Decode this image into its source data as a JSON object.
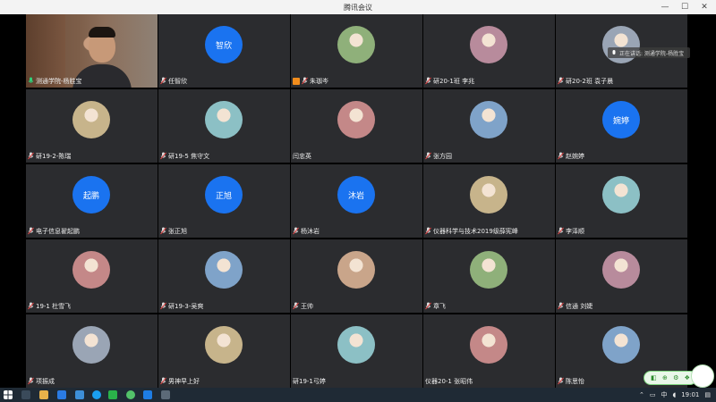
{
  "window": {
    "title": "腾讯会议",
    "minimize": "—",
    "maximize": "☐",
    "close": "✕"
  },
  "speaking": {
    "label": "正在讲话: 测通学院-杨胜宝"
  },
  "participants": [
    {
      "name": "测通学院-杨胜宝",
      "type": "video",
      "mic": "on"
    },
    {
      "name": "任智欣",
      "type": "text",
      "initials": "智欣",
      "mic": "muted"
    },
    {
      "name": "朱珈岑",
      "type": "image",
      "mic": "muted",
      "badge": true
    },
    {
      "name": "研20-1班 李兆",
      "type": "image",
      "mic": "muted"
    },
    {
      "name": "研20-2班 袁子晨",
      "type": "image",
      "mic": "muted"
    },
    {
      "name": "研19-2-陈瑞",
      "type": "image",
      "mic": "muted"
    },
    {
      "name": "研19-5 焦守文",
      "type": "image",
      "mic": "muted"
    },
    {
      "name": "闫忠英",
      "type": "image",
      "mic": "none"
    },
    {
      "name": "张方园",
      "type": "image",
      "mic": "muted"
    },
    {
      "name": "赵婉婷",
      "type": "text",
      "initials": "婉婷",
      "mic": "muted"
    },
    {
      "name": "电子信息翟起鹏",
      "type": "text",
      "initials": "起鹏",
      "mic": "muted"
    },
    {
      "name": "张正旭",
      "type": "text",
      "initials": "正旭",
      "mic": "muted"
    },
    {
      "name": "杨沐岩",
      "type": "text",
      "initials": "沐岩",
      "mic": "muted"
    },
    {
      "name": "仪器科学与技术2019级薛宪峰",
      "type": "image",
      "mic": "muted"
    },
    {
      "name": "李泽顺",
      "type": "image",
      "mic": "muted"
    },
    {
      "name": "19-1 杜雪飞",
      "type": "image",
      "mic": "muted"
    },
    {
      "name": "研19-3-吴爽",
      "type": "image",
      "mic": "muted"
    },
    {
      "name": "王帅",
      "type": "image",
      "mic": "muted"
    },
    {
      "name": "章飞",
      "type": "image",
      "mic": "muted"
    },
    {
      "name": "信通 刘婕",
      "type": "image",
      "mic": "muted"
    },
    {
      "name": "项振成",
      "type": "image",
      "mic": "muted"
    },
    {
      "name": "男神早上好",
      "type": "image",
      "mic": "muted"
    },
    {
      "name": "研19-1弓婷",
      "type": "image",
      "mic": "none"
    },
    {
      "name": "仪器20-1 张昭伟",
      "type": "image",
      "mic": "none"
    },
    {
      "name": "陈思怡",
      "type": "image",
      "mic": "muted"
    }
  ],
  "colors": {
    "tile_bg": "#2b2c2f",
    "avatar_blue": "#1a73f0",
    "active_outline": "#2fd07a",
    "muted_red": "#e04848"
  },
  "taskbar": {
    "ime": "中",
    "time": "19:01"
  },
  "widget": {
    "items": [
      "◧",
      "⊕",
      "⚙",
      "❖"
    ]
  }
}
